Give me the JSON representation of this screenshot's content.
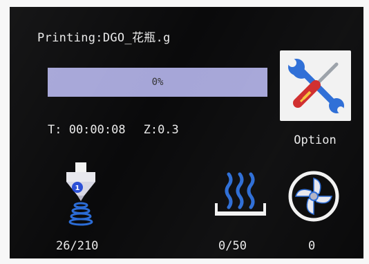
{
  "header": {
    "title": "Printing:DGO_花瓶.g"
  },
  "progress": {
    "percent": 0,
    "label": "0%"
  },
  "status": {
    "time": "T: 00:00:08",
    "z": "Z:0.3"
  },
  "option": {
    "label": "Option",
    "icon": "tools-icon"
  },
  "nozzle": {
    "icon": "nozzle-icon",
    "badge": "1",
    "value": "26/210"
  },
  "bed": {
    "icon": "heated-bed-icon",
    "value": "0/50"
  },
  "fan": {
    "icon": "fan-icon",
    "value": "0"
  },
  "colors": {
    "progress_track": "#a6a6d8",
    "screen_bg": "#0a0a0b",
    "nozzle_blue": "#2b6cd6",
    "accent_red": "#d02a2a"
  }
}
